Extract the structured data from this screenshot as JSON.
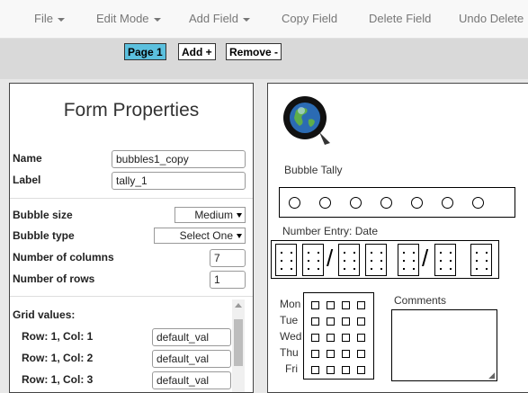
{
  "menu": {
    "file": "File",
    "edit_mode": "Edit Mode",
    "add_field": "Add Field",
    "copy_field": "Copy Field",
    "delete_field": "Delete Field",
    "undo_delete": "Undo Delete"
  },
  "toolbar": {
    "page1": "Page 1",
    "add": "Add +",
    "remove": "Remove -"
  },
  "form_properties": {
    "title": "Form Properties",
    "name_label": "Name",
    "name_value": "bubbles1_copy",
    "label_label": "Label",
    "label_value": "tally_1",
    "bubble_size_label": "Bubble size",
    "bubble_size_value": "Medium",
    "bubble_type_label": "Bubble type",
    "bubble_type_value": "Select One",
    "columns_label": "Number of columns",
    "columns_value": "7",
    "rows_label": "Number of rows",
    "rows_value": "1",
    "grid_values_label": "Grid values:",
    "grid_rows": [
      {
        "label": "Row: 1, Col: 1",
        "value": "default_val"
      },
      {
        "label": "Row: 1, Col: 2",
        "value": "default_val"
      },
      {
        "label": "Row: 1, Col: 3",
        "value": "default_val"
      }
    ]
  },
  "canvas": {
    "bubble_tally_label": "Bubble Tally",
    "bubble_count": 7,
    "number_entry_label": "Number Entry: Date",
    "days": [
      "Mon",
      "Tue",
      "Wed",
      "Thu",
      "Fri"
    ],
    "comments_label": "Comments"
  }
}
